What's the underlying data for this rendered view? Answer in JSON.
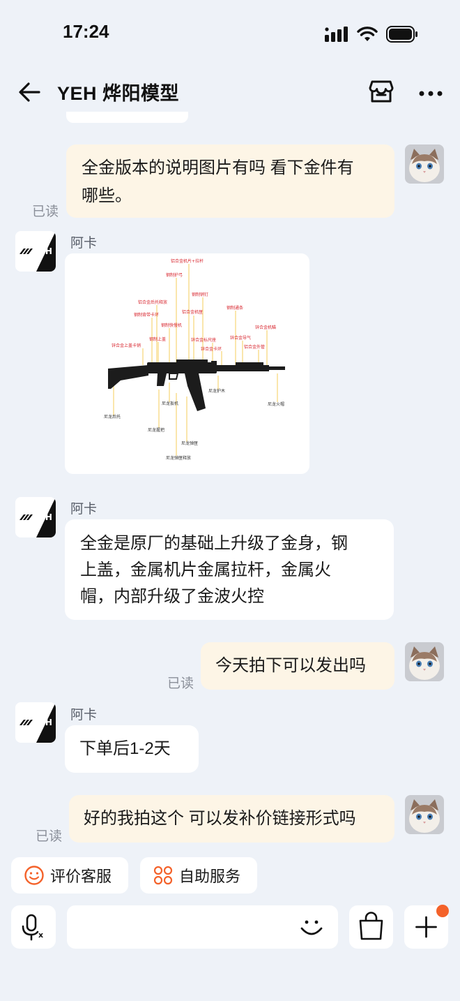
{
  "status_bar": {
    "time": "17:24"
  },
  "header": {
    "title": "YEH 烨阳模型"
  },
  "messages": [
    {
      "text": "全金版本的说明图片有吗 看下金件有哪些。",
      "line1": "全金版本的说明图片有吗 看下金件有",
      "line2": "哪些。",
      "read": "已读"
    },
    {
      "sender": "阿卡"
    },
    {
      "sender": "阿卡",
      "line1": "全金是原厂的基础上升级了金身，钢",
      "line2": "上盖，金属机片金属拉杆，金属火",
      "line3": "帽，内部升级了金波火控"
    },
    {
      "text": "今天拍下可以发出吗",
      "read": "已读"
    },
    {
      "sender": "阿卡",
      "text": "下单后1-2天"
    },
    {
      "text": "好的我拍这个 可以发补价链接形式吗",
      "read": "已读"
    }
  ],
  "diagram": {
    "labels": {
      "l01": "铝合金机片+拉杆",
      "l02": "钢制护弓",
      "l03": "钢制销钉",
      "l04": "铝合金后托释放",
      "l05": "钢制通条",
      "l06": "钢制背带卡环",
      "l07": "铝合金机匣",
      "l08": "钢制快慢机",
      "l09": "锌合金机瞄",
      "l10": "钢制上盖",
      "l11": "锌合金标尺座",
      "l12": "锌合金导气",
      "l13": "锌合金上盖卡销",
      "l14": "锌合金卡环",
      "l15": "铝合金外管",
      "l16": "尼龙护木",
      "l17": "尼龙扳机",
      "l18": "尼龙火帽",
      "l19": "尼龙后托",
      "l20": "尼龙握把",
      "l21": "尼龙弹匣",
      "l22": "尼龙弹匣释放"
    }
  },
  "quick_actions": {
    "rate_service": "评价客服",
    "self_service": "自助服务"
  },
  "colors": {
    "accent_orange": "#f4622a",
    "bubble_me": "#fdf5e6",
    "background": "#eef2f8",
    "label_red": "#d8262e"
  }
}
